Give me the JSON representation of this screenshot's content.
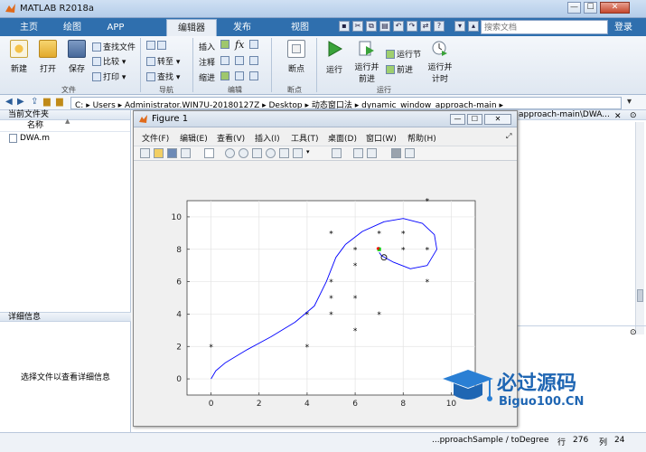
{
  "app": {
    "title": "MATLAB R2018a"
  },
  "window_buttons": {
    "minimize": "—",
    "maximize": "☐",
    "close": "✕"
  },
  "tabs": [
    "主页",
    "绘图",
    "APP",
    "编辑器",
    "发布",
    "视图"
  ],
  "search": {
    "placeholder": "搜索文档"
  },
  "login": "登录",
  "ribbon": {
    "file": {
      "new": "新建",
      "open": "打开",
      "save": "保存",
      "find_files": "查找文件",
      "compare": "比较",
      "print": "打印",
      "group": "文件"
    },
    "navigate": {
      "goto": "转至",
      "find": "查找",
      "group": "导航"
    },
    "edit": {
      "insert": "插入",
      "comment": "注释",
      "indent": "缩进",
      "fx": "fx",
      "group": "编辑"
    },
    "breakpoints": {
      "label": "断点",
      "group": "断点"
    },
    "run": {
      "run": "运行",
      "run_advance_1": "运行并",
      "run_advance_2": "前进",
      "run_section": "运行节",
      "advance": "前进",
      "run_time_1": "运行并",
      "run_time_2": "计时",
      "group": "运行"
    }
  },
  "address": {
    "path": [
      "C:",
      "Users",
      "Administrator.WIN7U-20180127Z",
      "Desktop",
      "动态窗口法",
      "dynamic_window_approach-main"
    ]
  },
  "left_panel": {
    "header": "当前文件夹",
    "column_name": "名称",
    "sort_arrow": "▲",
    "files": [
      "DWA.m"
    ],
    "details_header": "详细信息",
    "details_text": "选择文件以查看详细信息"
  },
  "right_panel": {
    "path_fragment": "approach-main\\DWA..."
  },
  "figure": {
    "title": "Figure 1",
    "menus": [
      "文件(F)",
      "编辑(E)",
      "查看(V)",
      "插入(I)",
      "工具(T)",
      "桌面(D)",
      "窗口(W)",
      "帮助(H)"
    ]
  },
  "status": {
    "function": "...pproachSample / toDegree",
    "row_label": "行",
    "row": "276",
    "col_label": "列",
    "col": "24"
  },
  "watermark": {
    "line1": "必过源码",
    "line2": "Biguo100.CN"
  },
  "chart_data": {
    "type": "scatter",
    "title": "",
    "xlabel": "",
    "ylabel": "",
    "xlim": [
      -1,
      11
    ],
    "ylim": [
      -1,
      11
    ],
    "xticks": [
      0,
      2,
      4,
      6,
      8,
      10
    ],
    "yticks": [
      0,
      2,
      4,
      6,
      8,
      10
    ],
    "grid": true,
    "series": [
      {
        "kind": "obstacles",
        "color": "#000000",
        "marker": "*",
        "points": [
          [
            0,
            2
          ],
          [
            4,
            2
          ],
          [
            4,
            4
          ],
          [
            5,
            4
          ],
          [
            5,
            5
          ],
          [
            5,
            6
          ],
          [
            5,
            9
          ],
          [
            6,
            3
          ],
          [
            6,
            5
          ],
          [
            6,
            7
          ],
          [
            6,
            8
          ],
          [
            7,
            4
          ],
          [
            7,
            8
          ],
          [
            7,
            9
          ],
          [
            8,
            8
          ],
          [
            8,
            9
          ],
          [
            9,
            6
          ],
          [
            9,
            8
          ],
          [
            9,
            11
          ]
        ]
      },
      {
        "kind": "trajectory",
        "color": "#0000ff",
        "points": [
          [
            0,
            0
          ],
          [
            0.2,
            0.5
          ],
          [
            0.6,
            1.0
          ],
          [
            1.5,
            1.8
          ],
          [
            2.5,
            2.6
          ],
          [
            3.5,
            3.5
          ],
          [
            4.3,
            4.5
          ],
          [
            4.8,
            6.0
          ],
          [
            5.2,
            7.5
          ],
          [
            5.6,
            8.3
          ],
          [
            6.3,
            9.1
          ],
          [
            7.2,
            9.7
          ],
          [
            8.0,
            9.9
          ],
          [
            8.8,
            9.6
          ],
          [
            9.3,
            8.9
          ],
          [
            9.4,
            8.0
          ],
          [
            9.0,
            7.0
          ],
          [
            8.3,
            6.8
          ],
          [
            7.6,
            7.2
          ],
          [
            7.1,
            7.6
          ],
          [
            7.0,
            7.8
          ]
        ]
      },
      {
        "kind": "robot",
        "color": "#000000",
        "points": [
          [
            7.2,
            7.5
          ]
        ]
      },
      {
        "kind": "goal",
        "color": "#00cc00",
        "points": [
          [
            7.0,
            8.0
          ]
        ]
      },
      {
        "kind": "heading",
        "color": "#ff0000",
        "points": [
          [
            6.95,
            8.05
          ]
        ]
      }
    ]
  }
}
